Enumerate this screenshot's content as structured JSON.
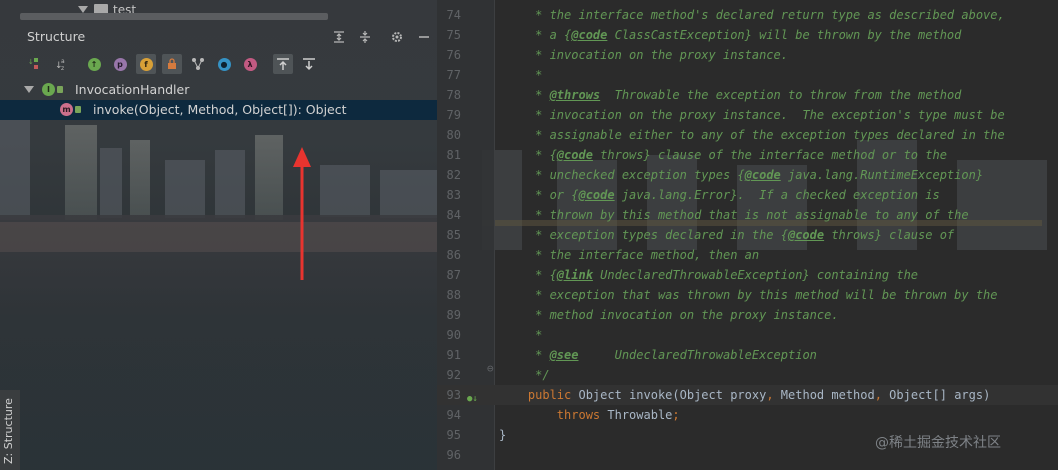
{
  "top_tree": {
    "folder_label": "test"
  },
  "panel": {
    "title": "Structure",
    "side_tab_label": "Z: Structure"
  },
  "toolbar": {
    "icons": [
      "sort-by-visibility-icon",
      "sort-alphabetically-icon",
      "show-inherited-icon",
      "show-properties-icon",
      "show-fields-icon",
      "show-non-public-icon",
      "show-anonymous-icon",
      "show-lambdas-icon",
      "autoscroll-to-source-icon",
      "autoscroll-from-source-icon"
    ]
  },
  "tree": {
    "root_label": "InvocationHandler",
    "child_label": "invoke(Object, Method, Object[]): Object"
  },
  "editor": {
    "lines": [
      {
        "n": "74",
        "parts": [
          [
            "doc",
            "     * the interface method's declared return type as described above,"
          ]
        ]
      },
      {
        "n": "75",
        "parts": [
          [
            "doc",
            "     * a {"
          ],
          [
            "tag",
            "@code"
          ],
          [
            "doc",
            " ClassCastException} will be thrown by the method"
          ]
        ]
      },
      {
        "n": "76",
        "parts": [
          [
            "doc",
            "     * invocation on the proxy instance."
          ]
        ]
      },
      {
        "n": "77",
        "parts": [
          [
            "doc",
            "     *"
          ]
        ]
      },
      {
        "n": "78",
        "parts": [
          [
            "doc",
            "     * "
          ],
          [
            "tag",
            "@throws"
          ],
          [
            "doc",
            "  Throwable the exception to throw from the method"
          ]
        ]
      },
      {
        "n": "79",
        "parts": [
          [
            "doc",
            "     * invocation on the proxy instance.  The exception's type must be"
          ]
        ]
      },
      {
        "n": "80",
        "parts": [
          [
            "doc",
            "     * assignable either to any of the exception types declared in the"
          ]
        ]
      },
      {
        "n": "81",
        "parts": [
          [
            "doc",
            "     * {"
          ],
          [
            "tag",
            "@code"
          ],
          [
            "doc",
            " throws} clause of the interface method or to the"
          ]
        ]
      },
      {
        "n": "82",
        "parts": [
          [
            "doc",
            "     * unchecked exception types {"
          ],
          [
            "tag",
            "@code"
          ],
          [
            "doc",
            " java.lang.RuntimeException}"
          ]
        ]
      },
      {
        "n": "83",
        "parts": [
          [
            "doc",
            "     * or {"
          ],
          [
            "tag",
            "@code"
          ],
          [
            "doc",
            " java.lang.Error}.  If a checked exception is"
          ]
        ]
      },
      {
        "n": "84",
        "parts": [
          [
            "doc",
            "     * thrown by this method that is not assignable to any of the"
          ]
        ]
      },
      {
        "n": "85",
        "parts": [
          [
            "doc",
            "     * exception types declared in the {"
          ],
          [
            "tag",
            "@code"
          ],
          [
            "doc",
            " throws} clause of"
          ]
        ]
      },
      {
        "n": "86",
        "parts": [
          [
            "doc",
            "     * the interface method, then an"
          ]
        ]
      },
      {
        "n": "87",
        "parts": [
          [
            "doc",
            "     * {"
          ],
          [
            "tag",
            "@link"
          ],
          [
            "doc",
            " UndeclaredThrowableException} containing the"
          ]
        ]
      },
      {
        "n": "88",
        "parts": [
          [
            "doc",
            "     * exception that was thrown by this method will be thrown by the"
          ]
        ]
      },
      {
        "n": "89",
        "parts": [
          [
            "doc",
            "     * method invocation on the proxy instance."
          ]
        ]
      },
      {
        "n": "90",
        "parts": [
          [
            "doc",
            "     *"
          ]
        ]
      },
      {
        "n": "91",
        "parts": [
          [
            "doc",
            "     * "
          ],
          [
            "tag",
            "@see"
          ],
          [
            "doc",
            "     UndeclaredThrowableException"
          ]
        ]
      },
      {
        "n": "92",
        "parts": [
          [
            "doc",
            "     */"
          ]
        ]
      },
      {
        "n": "93",
        "parts": [
          [
            "kw",
            "    public "
          ],
          [
            "plain",
            "Object "
          ],
          [
            "plain",
            "invoke(Object proxy"
          ],
          [
            "kw",
            ", "
          ],
          [
            "plain",
            "Method method"
          ],
          [
            "kw",
            ", "
          ],
          [
            "plain",
            "Object[] args)"
          ]
        ]
      },
      {
        "n": "94",
        "parts": [
          [
            "kw",
            "        throws "
          ],
          [
            "plain",
            "Throwable"
          ],
          [
            "kw",
            ";"
          ]
        ]
      },
      {
        "n": "95",
        "parts": [
          [
            "plain",
            "}"
          ]
        ]
      },
      {
        "n": "96",
        "parts": []
      }
    ]
  },
  "watermark": "@稀土掘金技术社区",
  "colors": {
    "doc_comment": "#629755",
    "keyword": "#cc7832",
    "text": "#a9b7c6",
    "selection": "#0d293e",
    "arrow": "#e8342f"
  }
}
